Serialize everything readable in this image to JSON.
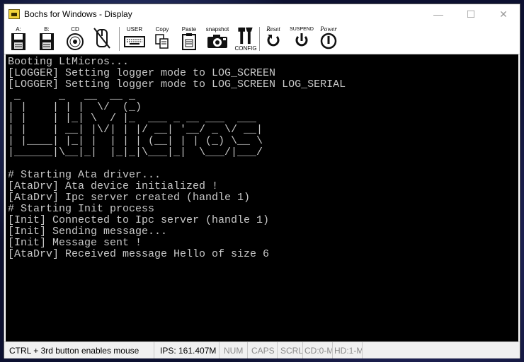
{
  "window": {
    "title": "Bochs for Windows - Display",
    "controls": {
      "minimize": "—",
      "maximize": "☐",
      "close": "✕"
    }
  },
  "toolbar": {
    "floppy_a": "A:",
    "floppy_b": "B:",
    "cdrom": "CD",
    "mouse": "",
    "user": "USER",
    "copy": "Copy",
    "paste": "Paste",
    "snapshot": "snapshot",
    "config": "CONFIG",
    "reset": "Reset",
    "suspend": "SUSPEND",
    "power": "Power"
  },
  "console": {
    "lines": [
      "Booting LtMicros...",
      "[LOGGER] Setting logger mode to LOG_SCREEN",
      "[LOGGER] Setting logger mode to LOG_SCREEN LOG_SERIAL",
      " _      _   __  __ _",
      "| |    | | |  \\/  (_)",
      "| |    | |_| \\  / |_  ___ _ __ ___  ___",
      "| |    | __| |\\/| | |/ __| '__/ _ \\/ __|",
      "| |____| |_| |  | | | (__| | | (_) \\__ \\",
      "|______|\\__|_|  |_|_|\\___|_|  \\___/|___/",
      "",
      "# Starting Ata driver...",
      "[AtaDrv] Ata device initialized !",
      "[AtaDrv] Ipc server created (handle 1)",
      "# Starting Init process",
      "[Init] Connected to Ipc server (handle 1)",
      "[Init] Sending message...",
      "[Init] Message sent !",
      "[AtaDrv] Received message Hello of size 6"
    ]
  },
  "statusbar": {
    "mouse_hint": "CTRL + 3rd button enables mouse",
    "ips": "IPS: 161.407M",
    "num": "NUM",
    "caps": "CAPS",
    "scrl": "SCRL",
    "cd": "CD:0-M",
    "hd": "HD:1-M"
  },
  "colors": {
    "screen_bg": "#000000",
    "console_text": "#c8c8c8",
    "statusbar_bg": "#f0f0f0"
  }
}
